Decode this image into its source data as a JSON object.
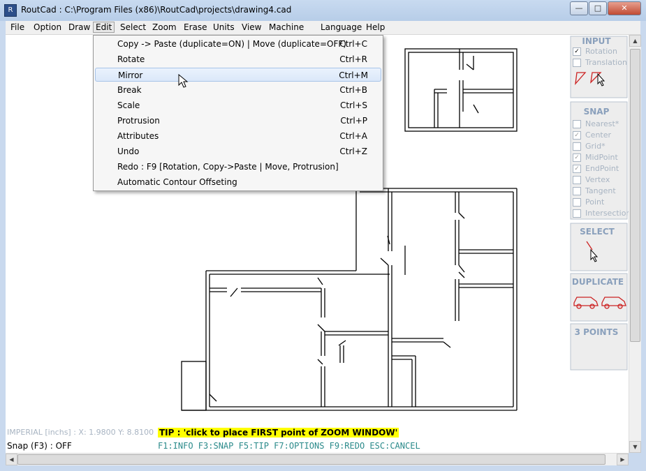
{
  "window": {
    "title": "RoutCad : C:\\Program Files (x86)\\RoutCad\\projects\\drawing4.cad",
    "icon": "routcad-app-icon",
    "minimize": "minimize-icon",
    "maximize": "maximize-icon",
    "close": "close-icon"
  },
  "menubar": [
    "File",
    "Option",
    "Draw",
    "Edit",
    "Select",
    "Zoom",
    "Erase",
    "Units",
    "View",
    "Machine",
    "Language",
    "Help"
  ],
  "edit_menu": {
    "items": [
      {
        "label": "Copy -> Paste (duplicate=ON) | Move (duplicate=OFF)",
        "shortcut": "Ctrl+C"
      },
      {
        "label": "Rotate",
        "shortcut": "Ctrl+R"
      },
      {
        "label": "Mirror",
        "shortcut": "Ctrl+M",
        "highlighted": true
      },
      {
        "label": "Break",
        "shortcut": "Ctrl+B"
      },
      {
        "label": "Scale",
        "shortcut": "Ctrl+S"
      },
      {
        "label": "Protrusion",
        "shortcut": "Ctrl+P"
      },
      {
        "label": "Attributes",
        "shortcut": "Ctrl+A"
      },
      {
        "label": "Undo",
        "shortcut": "Ctrl+Z"
      },
      {
        "label": "Redo : F9 [Rotation, Copy->Paste | Move, Protrusion]",
        "shortcut": ""
      },
      {
        "label": "Automatic Contour Offseting",
        "shortcut": ""
      }
    ]
  },
  "panel": {
    "input": {
      "title": "INPUT",
      "options": [
        {
          "label": "Rotation",
          "checked": true
        },
        {
          "label": "Translation",
          "checked": false
        }
      ]
    },
    "snap": {
      "title": "SNAP",
      "options": [
        {
          "label": "Nearest*",
          "checked": false
        },
        {
          "label": "Center",
          "checked": true
        },
        {
          "label": "Grid*",
          "checked": false
        },
        {
          "label": "MidPoint",
          "checked": true
        },
        {
          "label": "EndPoint",
          "checked": true
        },
        {
          "label": "Vertex",
          "checked": false
        },
        {
          "label": "Tangent",
          "checked": false
        },
        {
          "label": "Point",
          "checked": false
        },
        {
          "label": "Intersection*",
          "checked": false
        }
      ]
    },
    "select": {
      "title": "SELECT"
    },
    "duplicate": {
      "title": "DUPLICATE"
    },
    "three_points": {
      "title": "3 POINTS"
    }
  },
  "status": {
    "coords": "IMPERIAL [inchs] : X: 1.9800  Y: 8.8100",
    "snap": "Snap (F3) : OFF",
    "tip": "TIP : 'click to place FIRST point of  ZOOM WINDOW'",
    "keys": "F1:INFO  F3:SNAP  F5:TIP  F7:OPTIONS  F9:REDO  ESC:CANCEL"
  },
  "colors": {
    "accent": "#8aa0bc",
    "tip_bg": "#ffff00",
    "keys": "#2a8a8a",
    "drawing": "#000000",
    "tool_icon": "#cc2222"
  }
}
